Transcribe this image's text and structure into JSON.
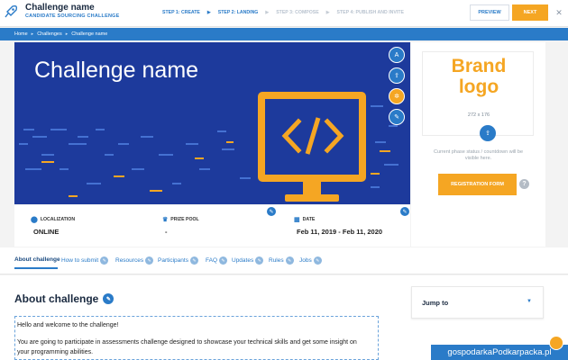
{
  "header": {
    "title": "Challenge name",
    "subtitle": "CANDIDATE SOURCING CHALLENGE",
    "steps": [
      {
        "label": "STEP 1: CREATE",
        "active": true
      },
      {
        "label": "STEP 2: LANDING",
        "active": true
      },
      {
        "label": "STEP 3: COMPOSE",
        "active": false
      },
      {
        "label": "STEP 4: PUBLISH AND INVITE",
        "active": false
      }
    ],
    "preview_label": "PREVIEW",
    "next_label": "NEXT",
    "close_glyph": "✕",
    "icon": "rocket-icon"
  },
  "breadcrumb": [
    "Home",
    "Challenges",
    "Challenge name"
  ],
  "hero": {
    "title": "Challenge name",
    "illustration": "monitor-code-icon",
    "side_icons": [
      "text-icon",
      "upload-icon",
      "settings-icon",
      "pencil-icon"
    ]
  },
  "brand": {
    "text_line1": "Brand",
    "text_line2": "logo",
    "size": "272 x 176",
    "phase_text": "Current phase status / countdown will be visible here.",
    "register_label": "REGISTRATION FORM",
    "help_glyph": "?"
  },
  "info": {
    "localization_label": "LOCALIZATION",
    "localization_value": "ONLINE",
    "prize_label": "PRIZE POOL",
    "prize_value": "-",
    "date_label": "DATE",
    "date_value": "Feb 11, 2019 - Feb 11, 2020"
  },
  "tabs": [
    "About challenge",
    "How to submit",
    "Resources",
    "Participants",
    "FAQ",
    "Updates",
    "Rules",
    "Jobs"
  ],
  "content": {
    "heading": "About challenge",
    "line1": "Hello and welcome to the challenge!",
    "line2": "You are going to participate in assessments challenge designed to showcase your technical skills and get some insight on",
    "line3": "your programming abilities.",
    "jump_label": "Jump to"
  },
  "watermark": "gospodarkaPodkarpacka.pl",
  "colors": {
    "primary": "#2a7bc8",
    "accent": "#f5a623",
    "hero_bg": "#1d3a9c"
  }
}
